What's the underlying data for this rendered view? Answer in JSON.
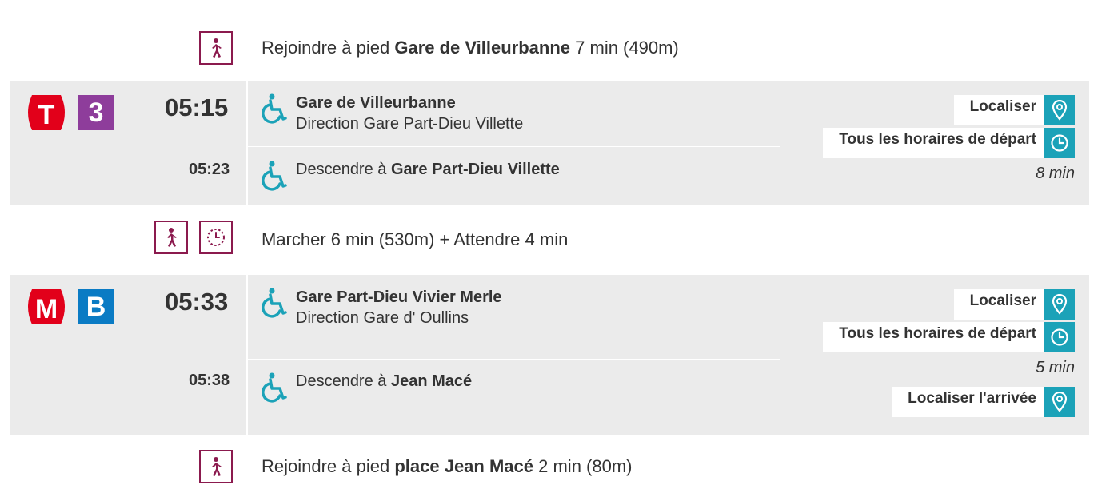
{
  "walk_start": {
    "prefix": "Rejoindre à pied ",
    "stop": "Gare de Villeurbanne",
    "suffix": " 7 min (490m)"
  },
  "leg1": {
    "mode_letter": "T",
    "line": "3",
    "mode_color": "#e2001a",
    "line_color": "#8e3d9b",
    "depart_time": "05:15",
    "arrive_time": "05:23",
    "board_stop": "Gare de Villeurbanne",
    "direction": "Direction Gare Part-Dieu Villette",
    "alight_prefix": "Descendre à ",
    "alight_stop": "Gare Part-Dieu Villette",
    "locate_label": "Localiser",
    "timetable_label": "Tous les horaires de départ",
    "duration": "8 min"
  },
  "transfer": {
    "text": "Marcher 6 min (530m) + Attendre 4 min"
  },
  "leg2": {
    "mode_letter": "M",
    "line": "B",
    "mode_color": "#e2001a",
    "line_color": "#0a7bc4",
    "depart_time": "05:33",
    "arrive_time": "05:38",
    "board_stop": "Gare Part-Dieu Vivier Merle",
    "direction": "Direction Gare d' Oullins",
    "alight_prefix": "Descendre à ",
    "alight_stop": "Jean Macé",
    "locate_label": "Localiser",
    "timetable_label": "Tous les horaires de départ",
    "duration": "5 min",
    "locate_arrival_label": "Localiser l'arrivée"
  },
  "walk_end": {
    "prefix": "Rejoindre à pied ",
    "stop": "place Jean Macé",
    "suffix": " 2 min (80m)"
  },
  "icons": {
    "walk": "walking-person-icon",
    "wait": "wait-clock-icon",
    "accessible": "wheelchair-icon",
    "locate": "map-pin-icon",
    "timetable": "clock-icon"
  },
  "colors": {
    "walk_icon": "#8b1a4e",
    "action_button": "#1ba2b8",
    "accessible": "#1ba2b8",
    "section_bg": "#ebebeb"
  }
}
